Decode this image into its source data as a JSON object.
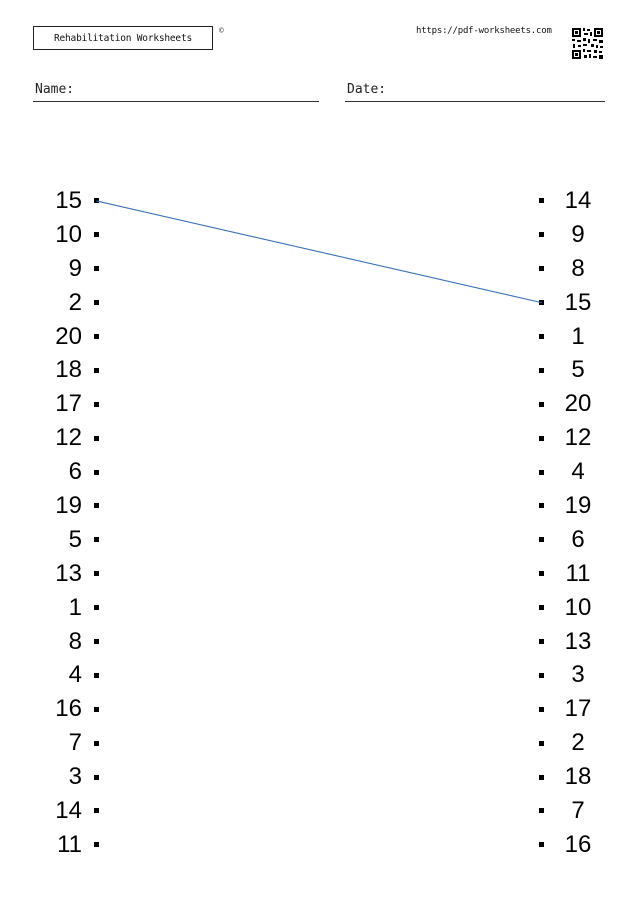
{
  "header": {
    "brand": "Rehabilitation Worksheets",
    "copyright_symbol": "©",
    "url": "https://pdf-worksheets.com",
    "qr_icon": "qr-code-icon"
  },
  "fields": {
    "name_label": "Name:",
    "date_label": "Date:"
  },
  "left_numbers": [
    "15",
    "10",
    "9",
    "2",
    "20",
    "18",
    "17",
    "12",
    "6",
    "19",
    "5",
    "13",
    "1",
    "8",
    "4",
    "16",
    "7",
    "3",
    "14",
    "11"
  ],
  "right_numbers": [
    "14",
    "9",
    "8",
    "15",
    "1",
    "5",
    "20",
    "12",
    "4",
    "19",
    "6",
    "11",
    "10",
    "13",
    "3",
    "17",
    "2",
    "18",
    "7",
    "16"
  ],
  "connections": [
    {
      "left_index": 0,
      "right_index": 3
    }
  ],
  "colors": {
    "connection_line": "#3a6fb5"
  }
}
